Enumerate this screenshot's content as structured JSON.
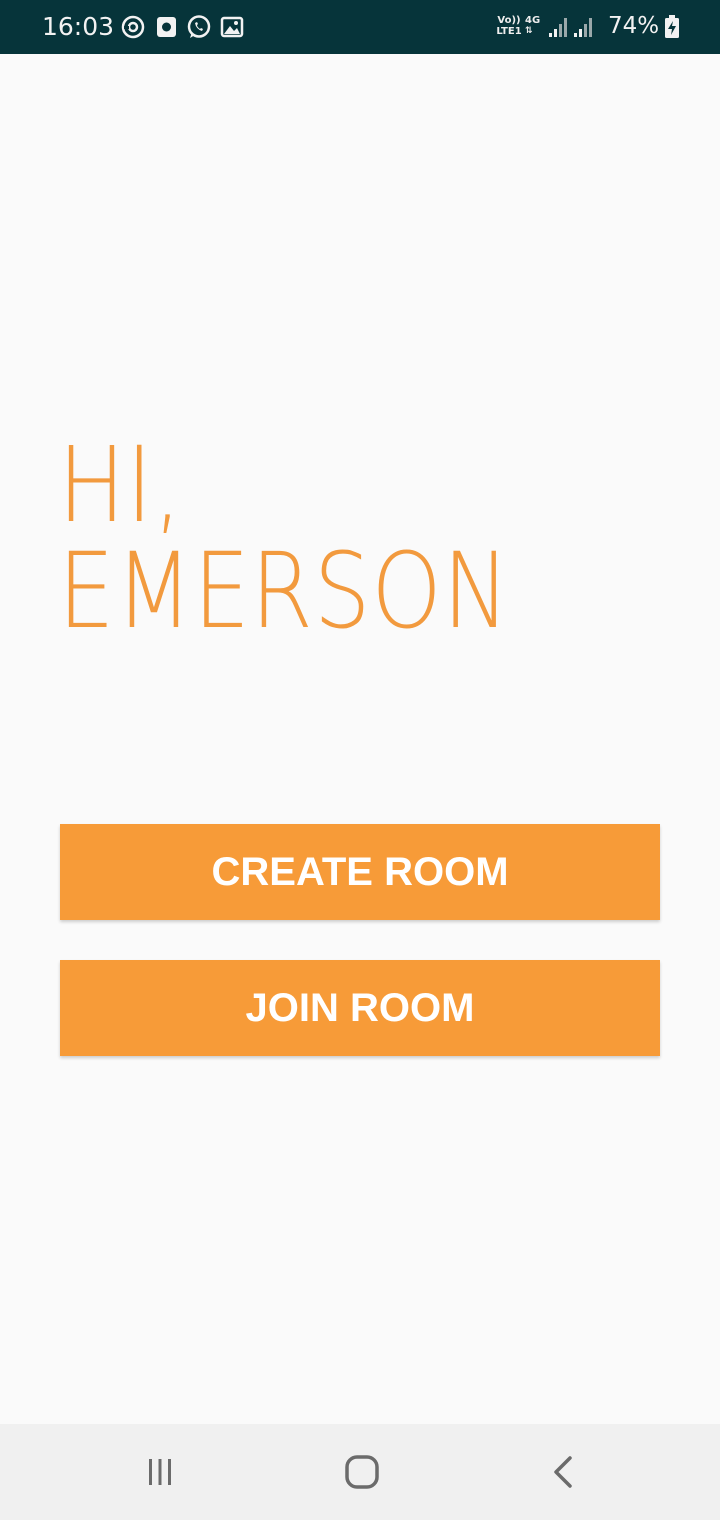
{
  "status_bar": {
    "time": "16:03",
    "notification_icons": [
      "sync-icon",
      "screen-recorder-icon",
      "whatsapp-icon",
      "gallery-icon"
    ],
    "network_volte": "Vo))",
    "network_lte": "LTE1",
    "network_4g": "4G",
    "battery_percent": "74%",
    "background_color": "#06343a"
  },
  "main": {
    "greeting_line1": "HI,",
    "greeting_line2": "EMERSON",
    "create_room_label": "CREATE ROOM",
    "join_room_label": "JOIN ROOM",
    "accent_color": "#f79b38"
  },
  "nav_bar": {
    "buttons": [
      "recent-apps-icon",
      "home-icon",
      "back-icon"
    ]
  }
}
